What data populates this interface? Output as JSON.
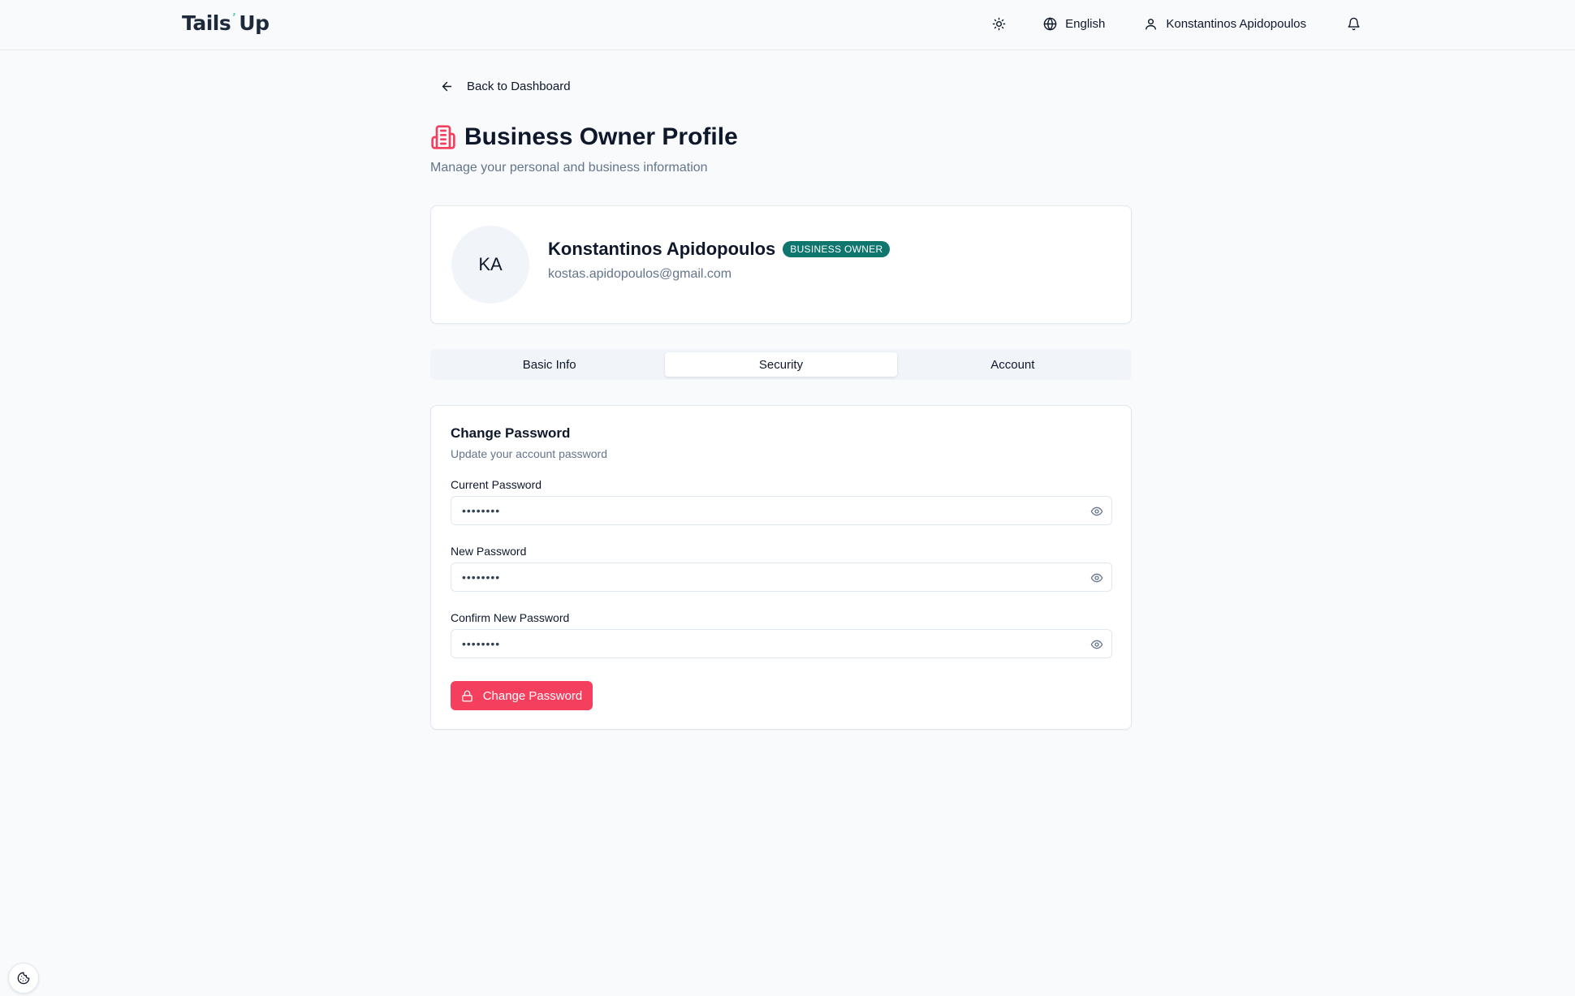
{
  "header": {
    "logo": {
      "part1": "Tails",
      "part2": "Up"
    },
    "theme_icon": "sun-icon",
    "language": "English",
    "user_name": "Konstantinos Apidopoulos",
    "notifications_icon": "bell-icon"
  },
  "nav": {
    "back_label": "Back to Dashboard"
  },
  "page": {
    "title": "Business Owner Profile",
    "subtitle": "Manage your personal and business information",
    "title_icon": "building-icon"
  },
  "profile": {
    "initials": "KA",
    "name": "Konstantinos Apidopoulos",
    "role_badge": "BUSINESS OWNER",
    "email": "kostas.apidopoulos@gmail.com"
  },
  "tabs": [
    {
      "label": "Basic Info",
      "active": false
    },
    {
      "label": "Security",
      "active": true
    },
    {
      "label": "Account",
      "active": false
    }
  ],
  "change_password": {
    "title": "Change Password",
    "description": "Update your account password",
    "fields": [
      {
        "label": "Current Password",
        "value": "••••••••"
      },
      {
        "label": "New Password",
        "value": "••••••••"
      },
      {
        "label": "Confirm New Password",
        "value": "••••••••"
      }
    ],
    "submit_label": "Change Password"
  },
  "colors": {
    "accent": "#f43f5e",
    "badge": "#0f766e",
    "logo_accent": "#4fd1a5"
  }
}
